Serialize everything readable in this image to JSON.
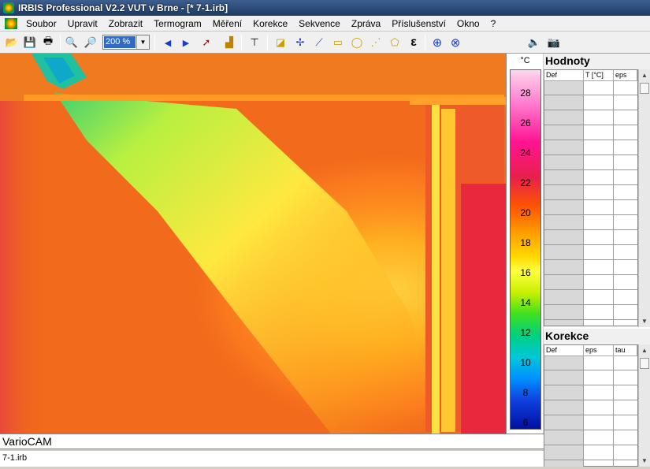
{
  "window": {
    "title": "IRBIS Professional V2.2   VUT v Brne - [* 7-1.irb]"
  },
  "menu": [
    "Soubor",
    "Upravit",
    "Zobrazit",
    "Termogram",
    "Měření",
    "Korekce",
    "Sekvence",
    "Zpráva",
    "Příslušenství",
    "Okno",
    "?"
  ],
  "toolbar": {
    "zoom_value": "200 %",
    "buttons": [
      {
        "name": "open-icon",
        "glyph": "📂"
      },
      {
        "name": "save-icon",
        "glyph": "💾"
      },
      {
        "name": "print-icon",
        "glyph": "🖶"
      },
      {
        "name": "zoom-in-icon",
        "glyph": "🔍"
      },
      {
        "name": "zoom-out-icon",
        "glyph": "🔎"
      },
      {
        "name": "prev-icon",
        "glyph": "◀"
      },
      {
        "name": "next-icon",
        "glyph": "▶"
      },
      {
        "name": "cursor-icon",
        "glyph": "➚"
      },
      {
        "name": "histogram-icon",
        "glyph": "▟"
      },
      {
        "name": "isotherm-icon",
        "glyph": "⊤"
      },
      {
        "name": "area-icon",
        "glyph": "◪"
      },
      {
        "name": "point-icon",
        "glyph": "✢"
      },
      {
        "name": "line-icon",
        "glyph": "⟋"
      },
      {
        "name": "rect-tool-icon",
        "glyph": "▭"
      },
      {
        "name": "ellipse-tool-icon",
        "glyph": "◯"
      },
      {
        "name": "polyline-tool-icon",
        "glyph": "⋰"
      },
      {
        "name": "polygon-tool-icon",
        "glyph": "⬠"
      },
      {
        "name": "epsilon-icon",
        "glyph": "ε"
      },
      {
        "name": "magnify-icon",
        "glyph": "⊕"
      },
      {
        "name": "magnify-area-icon",
        "glyph": "⊗"
      },
      {
        "name": "sound-icon",
        "glyph": "🔈"
      },
      {
        "name": "camera-icon",
        "glyph": "📷"
      }
    ]
  },
  "scale": {
    "unit": "°C",
    "ticks": [
      "28",
      "26",
      "24",
      "22",
      "20",
      "18",
      "16",
      "14",
      "12",
      "10",
      "8",
      "6"
    ]
  },
  "hodnoty": {
    "title": "Hodnoty",
    "columns": [
      "Def",
      "T [°C]",
      "eps"
    ]
  },
  "korekce": {
    "title": "Korekce",
    "columns": [
      "Def",
      "eps",
      "tau"
    ]
  },
  "status": {
    "camera": "VarioCAM",
    "file": "7-1.irb"
  }
}
